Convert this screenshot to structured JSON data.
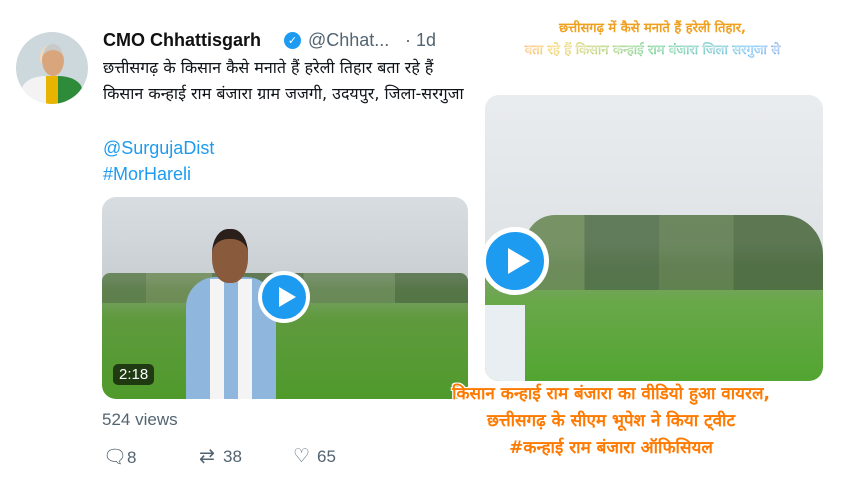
{
  "tweet": {
    "display_name": "CMO Chhattisgarh",
    "handle": "@Chhat...",
    "time": "· 1d",
    "text": "छत्तीसगढ़ के किसान कैसे मनाते हैं हरेली तिहार बता रहे हैं  किसान कन्हाई राम बंजारा ग्राम जजगी, उदयपुर, जिला-सरगुजा",
    "mention": "@SurgujaDist",
    "hashtag": "#MorHareli",
    "video_duration": "2:18",
    "views": "524 views",
    "replies": "8",
    "retweets": "38",
    "likes": "65"
  },
  "icons": {
    "verified": "verified-badge-icon",
    "play": "play-icon",
    "reply": "reply-icon",
    "retweet": "retweet-icon",
    "like": "heart-icon"
  },
  "overlay": {
    "top_line1": "छत्तीसगढ़ में कैसे मनाते हैं हरेली तिहार,",
    "top_line2": "बता रहे हैं किसान कन्हाई राम बंजारा जिला सरगुजा से",
    "bottom_line1": "किसान कन्हाई राम बंजारा का वीडियो हुआ वायरल,",
    "bottom_line2": "छत्तीसगढ़ के सीएम भूपेश ने किया ट्वीट",
    "bottom_line3": "#कन्हाई राम बंजारा ऑफिसियल"
  },
  "colors": {
    "accent": "#1d9bf0",
    "secondary_text": "#536471",
    "banner_orange": "#ff7a00"
  }
}
